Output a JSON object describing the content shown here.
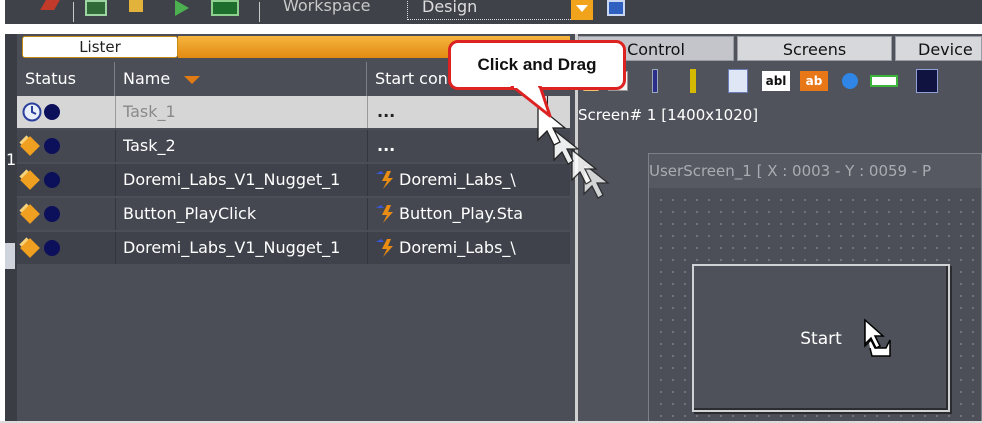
{
  "toolbar": {
    "workspace_label": "Workspace",
    "workspace_value": "Design"
  },
  "left_panel": {
    "tab_label": "Lister",
    "columns": [
      "Status",
      "Name",
      "Start con"
    ],
    "sort_indicator": "chevron-down-orange",
    "rows": [
      {
        "name": "Task_1",
        "start": "...",
        "status": "clock-idle"
      },
      {
        "name": "Task_2",
        "start": "...",
        "status": "task-running"
      },
      {
        "name": "Doremi_Labs_V1_Nugget_1",
        "start": "Doremi_Labs_\\",
        "status": "task-running"
      },
      {
        "name": "Button_PlayClick",
        "start": "Button_Play.Sta",
        "status": "task-running"
      },
      {
        "name": "Doremi_Labs_V1_Nugget_1",
        "start": "Doremi_Labs_\\",
        "status": "task-running"
      }
    ],
    "edge_digit": "1"
  },
  "right_panel": {
    "tabs": [
      "Control",
      "Screens",
      "Device"
    ],
    "screen_label": "Screen# 1 [1400x1020]",
    "user_screen_title": "UserScreen_1 [ X : 0003 - Y : 0059 - P",
    "start_button_label": "Start"
  },
  "callout": {
    "text": "Click and Drag"
  },
  "colors": {
    "accent": "#f0a31b",
    "panel": "#4b4e57",
    "callout_border": "#dd2222"
  }
}
